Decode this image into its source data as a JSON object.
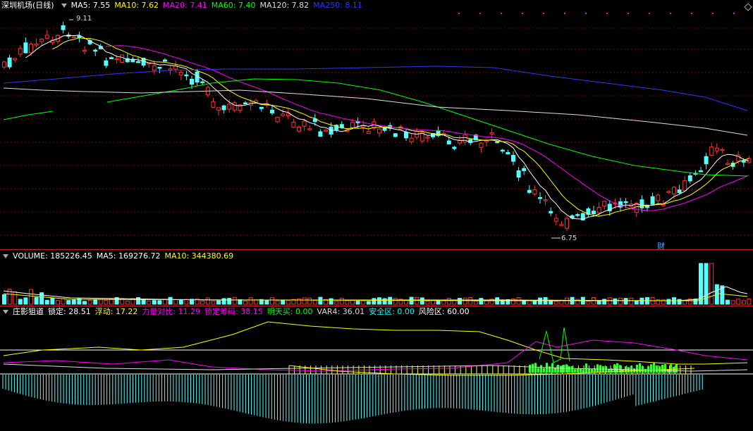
{
  "price": {
    "title": "深圳机场(日线)",
    "legend": [
      {
        "label": "MA5: 7.55",
        "color": "#ffffff"
      },
      {
        "label": "MA10: 7.62",
        "color": "#ffff00"
      },
      {
        "label": "MA20: 7.41",
        "color": "#ff00ff"
      },
      {
        "label": "MA60: 7.40",
        "color": "#00ff00"
      },
      {
        "label": "MA120: 7.82",
        "color": "#dddddd"
      },
      {
        "label": "MA250: 8.11",
        "color": "#3333ff"
      }
    ],
    "high_label": "9.11",
    "low_label": "6.75",
    "finance_tag": "财"
  },
  "volume": {
    "legend": [
      {
        "label": "VOLUME: 185226.45",
        "color": "#ffffff"
      },
      {
        "label": "MA5: 169276.72",
        "color": "#ffffff"
      },
      {
        "label": "MA10: 344380.69",
        "color": "#ffff00"
      }
    ]
  },
  "indicator": {
    "legend": [
      {
        "label": "庄影狙道",
        "color": "#ffffff"
      },
      {
        "label": "锁定: 28.51",
        "color": "#ffffff"
      },
      {
        "label": "浮动: 17.22",
        "color": "#ffff00"
      },
      {
        "label": "力量对比: 11.29",
        "color": "#ff00ff"
      },
      {
        "label": "锁定筹码: 38.15",
        "color": "#ff00ff"
      },
      {
        "label": "明天买: 0.00",
        "color": "#00ff00"
      },
      {
        "label": "VAR4: 36.01",
        "color": "#dddddd"
      },
      {
        "label": "安全区: 0.00",
        "color": "#00ffff"
      },
      {
        "label": "风险区: 60.00",
        "color": "#ffffff"
      }
    ]
  },
  "colors": {
    "up": "#ff3232",
    "down": "#54ffff",
    "grid": "#8b0000"
  }
}
